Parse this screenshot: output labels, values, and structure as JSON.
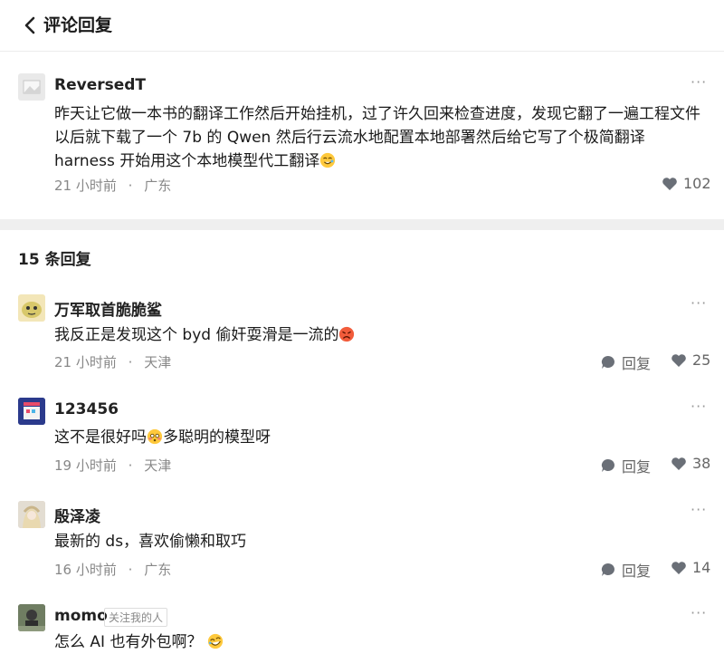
{
  "header": {
    "title": "评论回复"
  },
  "parent_comment": {
    "username": "ReversedT",
    "text": "昨天让它做一本书的翻译工作然后开始挂机，过了许久回来检查进度，发现它翻了一遍工程文件以后就下载了一个 7b 的 Qwen 然后行云流水地配置本地部署然后给它写了个极简翻译 harness 开始用这个本地模型代工翻译",
    "time": "21 小时前",
    "location": "广东",
    "likes": "102"
  },
  "replies_header": {
    "count_label": "15 条回复"
  },
  "reply_label": "回复",
  "dot": "·",
  "replies": [
    {
      "username": "万军取首脆脆鲨",
      "text": "我反正是发现这个 byd 偷奸耍滑是一流的",
      "time": "21 小时前",
      "location": "天津",
      "likes": "25"
    },
    {
      "username": "123456",
      "text_before": "这不是很好吗",
      "text_after": "多聪明的模型呀",
      "time": "19 小时前",
      "location": "天津",
      "likes": "38"
    },
    {
      "username": "殷泽凌",
      "text": "最新的 ds，喜欢偷懒和取巧",
      "time": "16 小时前",
      "location": "广东",
      "likes": "14"
    },
    {
      "username": "momo",
      "badge": "关注我的人",
      "text": "怎么 AI 也有外包啊？"
    }
  ],
  "colors": {
    "text": "#1a1a1a",
    "meta": "#888888",
    "separator": "#efefef",
    "icon": "#666666"
  },
  "icons": [
    "back-icon",
    "more-icon",
    "heart-icon",
    "comment-icon",
    "emoji-icon"
  ]
}
